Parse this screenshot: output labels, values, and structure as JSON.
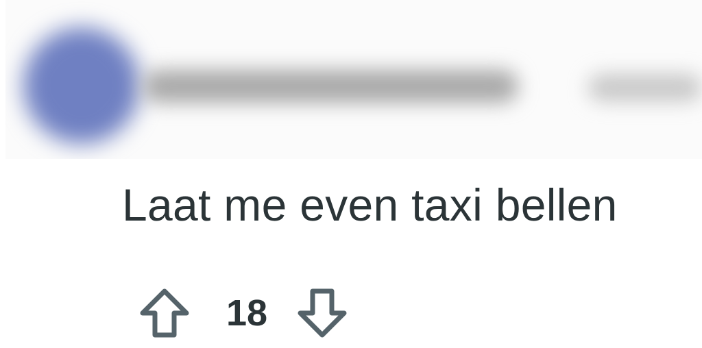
{
  "comment": {
    "author": {
      "avatar_icon": "user-avatar-blurred",
      "avatar_color": "#6f80c2"
    },
    "body": "Laat me even taxi bellen",
    "votes": {
      "score": "18",
      "upvote_icon": "arrow-up-outline-icon",
      "downvote_icon": "arrow-down-outline-icon"
    },
    "colors": {
      "text": "#2b3437",
      "icon": "#55636a"
    }
  }
}
